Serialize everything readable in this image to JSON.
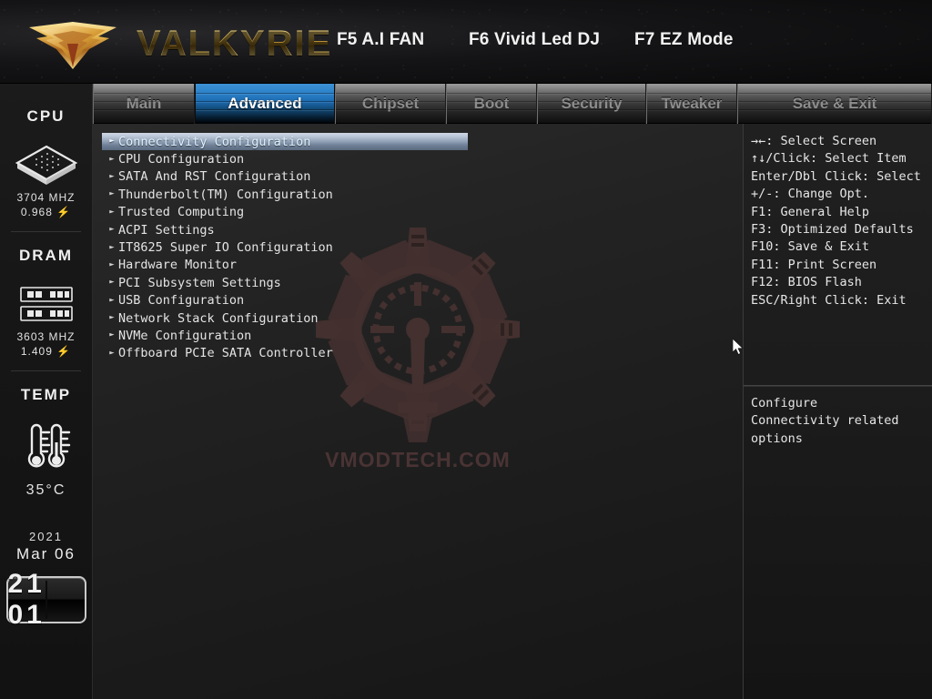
{
  "banner": {
    "brand": "VALKYRIE",
    "hotkeys": [
      {
        "label": "F5 A.I FAN"
      },
      {
        "label": "F6 Vivid Led DJ"
      },
      {
        "label": "F7 EZ Mode"
      }
    ]
  },
  "tabs": [
    {
      "label": "Main",
      "active": false
    },
    {
      "label": "Advanced",
      "active": true
    },
    {
      "label": "Chipset",
      "active": false
    },
    {
      "label": "Boot",
      "active": false
    },
    {
      "label": "Security",
      "active": false
    },
    {
      "label": "Tweaker",
      "active": false
    },
    {
      "label": "Save & Exit",
      "active": false
    }
  ],
  "sidebar": {
    "cpu": {
      "title": "CPU",
      "icon": "cpu-chip-icon",
      "frequency": "3704 MHZ",
      "voltage": "0.968 ⚡"
    },
    "dram": {
      "title": "DRAM",
      "icon": "memory-module-icon",
      "frequency": "3603 MHZ",
      "voltage": "1.409 ⚡"
    },
    "temp": {
      "title": "TEMP",
      "icon": "thermometer-icon",
      "value": "35°C"
    },
    "clock": {
      "year": "2021",
      "month_day": "Mar 06",
      "time": "21 01"
    }
  },
  "main": {
    "watermark": {
      "text": "VMODTECH.COM",
      "emblem": "radial-emblem-icon"
    },
    "menu_items": [
      {
        "label": "Connectivity Configuration",
        "selected": true
      },
      {
        "label": "CPU Configuration",
        "selected": false
      },
      {
        "label": "SATA And RST Configuration",
        "selected": false
      },
      {
        "label": "Thunderbolt(TM) Configuration",
        "selected": false
      },
      {
        "label": "Trusted Computing",
        "selected": false
      },
      {
        "label": "ACPI Settings",
        "selected": false
      },
      {
        "label": "IT8625 Super IO Configuration",
        "selected": false
      },
      {
        "label": "Hardware Monitor",
        "selected": false
      },
      {
        "label": "PCI Subsystem Settings",
        "selected": false
      },
      {
        "label": "USB Configuration",
        "selected": false
      },
      {
        "label": "Network Stack Configuration",
        "selected": false
      },
      {
        "label": "NVMe Configuration",
        "selected": false
      },
      {
        "label": "Offboard PCIe SATA Controller",
        "selected": false
      }
    ]
  },
  "help": {
    "keys": [
      "→←: Select Screen",
      "↑↓/Click: Select Item",
      "Enter/Dbl Click: Select",
      "+/-: Change Opt.",
      "F1: General Help",
      "F3: Optimized Defaults",
      "F10: Save & Exit",
      "F11: Print Screen",
      "F12: BIOS Flash",
      "ESC/Right Click: Exit"
    ],
    "description": [
      "Configure",
      "Connectivity related",
      "options"
    ]
  },
  "colors": {
    "accent_blue": "#2a7fc6",
    "brand_gold": "#e0b850",
    "selection": "#93a3b8",
    "watermark": "#4a3334"
  }
}
